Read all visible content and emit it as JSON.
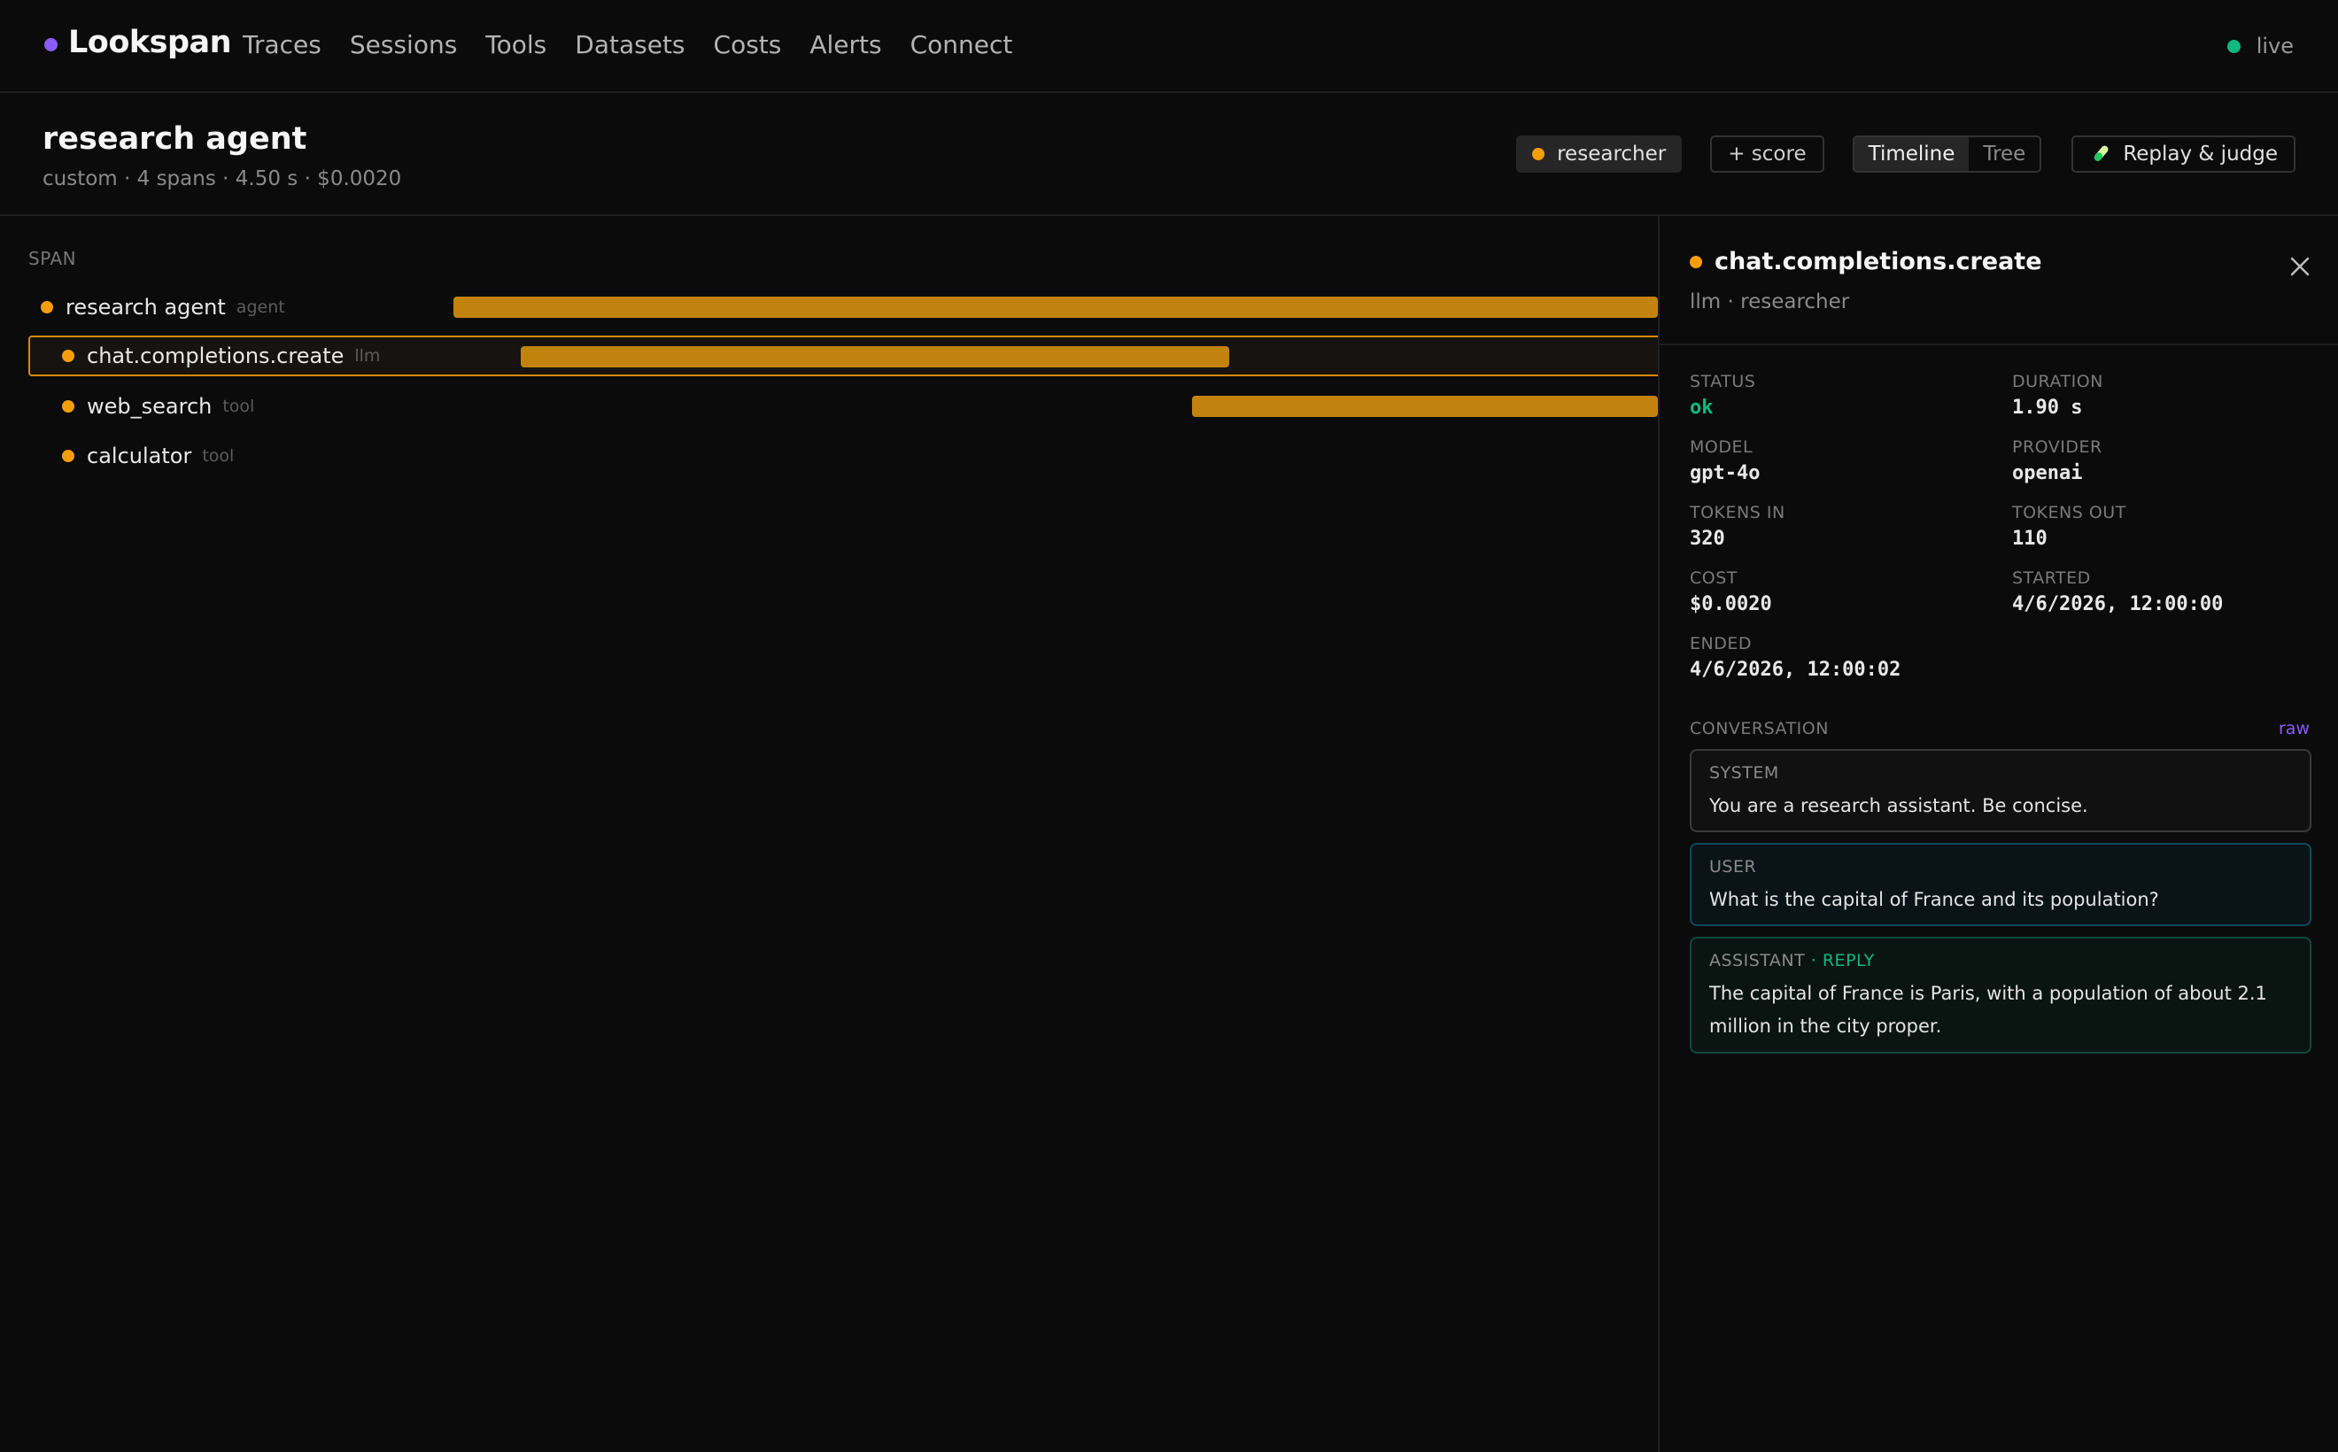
{
  "app": {
    "brand": "Lookspan",
    "nav": [
      "Traces",
      "Sessions",
      "Tools",
      "Datasets",
      "Costs",
      "Alerts",
      "Connect"
    ],
    "live_label": "live"
  },
  "trace": {
    "title": "research agent",
    "meta": "custom · 4 spans · 4.50 s · $0.0020",
    "tag": "researcher",
    "score_button": "+ score",
    "view_tabs": [
      "Timeline",
      "Tree"
    ],
    "active_view": "Timeline",
    "replay_button": "Replay & judge"
  },
  "timeline": {
    "column_header": "SPAN",
    "spans": [
      {
        "name": "research agent",
        "kind": "agent",
        "start_s": 0.0,
        "end_s": 4.5
      },
      {
        "name": "chat.completions.create",
        "kind": "llm",
        "start_s": 0.18,
        "end_s": 2.08,
        "selected": true
      },
      {
        "name": "web_search",
        "kind": "tool",
        "start_s": 1.98,
        "end_s": 4.5
      },
      {
        "name": "calculator",
        "kind": "tool"
      }
    ],
    "bar_color": "#c2830e"
  },
  "detail": {
    "title": "chat.completions.create",
    "subtitle": "llm · researcher",
    "fields": [
      {
        "label": "STATUS",
        "value": "ok"
      },
      {
        "label": "DURATION",
        "value": "1.90 s"
      },
      {
        "label": "MODEL",
        "value": "gpt-4o"
      },
      {
        "label": "PROVIDER",
        "value": "openai"
      },
      {
        "label": "TOKENS IN",
        "value": "320"
      },
      {
        "label": "TOKENS OUT",
        "value": "110"
      },
      {
        "label": "COST",
        "value": "$0.0020"
      },
      {
        "label": "STARTED",
        "value": "4/6/2026, 12:00:00"
      },
      {
        "label": "ENDED",
        "value": "4/6/2026, 12:00:02"
      }
    ],
    "conversation_label": "CONVERSATION",
    "raw_link": "raw",
    "messages": [
      {
        "role": "SYSTEM",
        "text": "You are a research assistant. Be concise."
      },
      {
        "role": "USER",
        "text": "What is the capital of France and its population?"
      },
      {
        "role": "ASSISTANT",
        "role_suffix": "· REPLY",
        "text": "The capital of France is Paris, with a population of about 2.1 million in the city proper."
      }
    ]
  },
  "colors": {
    "accent": "#8b5cf6",
    "span": "#f59e0b",
    "ok": "#10b981"
  }
}
